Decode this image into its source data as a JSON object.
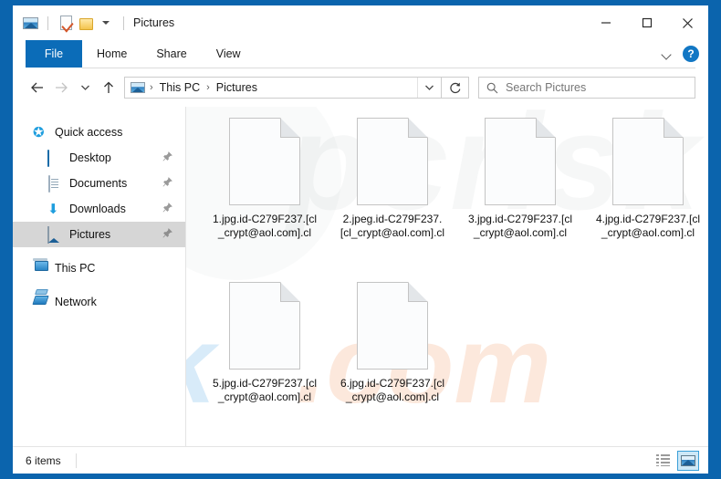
{
  "window": {
    "title": "Pictures",
    "quick_access_toolbar": [
      {
        "name": "picture-icon",
        "tooltip": "Pictures"
      },
      {
        "name": "properties-icon",
        "tooltip": "Properties"
      },
      {
        "name": "new-folder-icon",
        "tooltip": "New folder"
      },
      {
        "name": "chevron-down-icon",
        "tooltip": "Customize Quick Access Toolbar"
      }
    ],
    "controls": {
      "minimize": "minimize-icon",
      "maximize": "maximize-icon",
      "close": "close-icon"
    }
  },
  "ribbon": {
    "tabs": [
      {
        "label": "File",
        "active": true
      },
      {
        "label": "Home",
        "active": false
      },
      {
        "label": "Share",
        "active": false
      },
      {
        "label": "View",
        "active": false
      }
    ],
    "expand_icon": "chevron-down-icon",
    "help_label": "?"
  },
  "address_bar": {
    "back_icon": "arrow-left-icon",
    "forward_icon": "arrow-right-icon",
    "history_icon": "chevron-down-icon",
    "up_icon": "arrow-up-icon",
    "location_icon": "picture-folder-icon",
    "breadcrumbs": [
      "This PC",
      "Pictures"
    ],
    "separator": "›",
    "dropdown_icon": "chevron-down-icon",
    "refresh_icon": "refresh-icon"
  },
  "search": {
    "icon": "search-icon",
    "placeholder": "Search Pictures",
    "value": ""
  },
  "sidebar": {
    "items": [
      {
        "label": "Quick access",
        "icon": "star-icon",
        "level": 0,
        "pinned": false,
        "selected": false
      },
      {
        "label": "Desktop",
        "icon": "desktop-icon",
        "level": 1,
        "pinned": true,
        "selected": false
      },
      {
        "label": "Documents",
        "icon": "documents-icon",
        "level": 1,
        "pinned": true,
        "selected": false
      },
      {
        "label": "Downloads",
        "icon": "downloads-icon",
        "level": 1,
        "pinned": true,
        "selected": false
      },
      {
        "label": "Pictures",
        "icon": "pictures-icon",
        "level": 1,
        "pinned": true,
        "selected": true
      },
      {
        "label": "This PC",
        "icon": "this-pc-icon",
        "level": 0,
        "pinned": false,
        "selected": false
      },
      {
        "label": "Network",
        "icon": "network-icon",
        "level": 0,
        "pinned": false,
        "selected": false
      }
    ]
  },
  "files": [
    {
      "name": "1.jpg.id-C279F237.[cl_crypt@aol.com].cl",
      "icon": "blank-file-icon"
    },
    {
      "name": "2.jpeg.id-C279F237.[cl_crypt@aol.com].cl",
      "icon": "blank-file-icon"
    },
    {
      "name": "3.jpg.id-C279F237.[cl_crypt@aol.com].cl",
      "icon": "blank-file-icon"
    },
    {
      "name": "4.jpg.id-C279F237.[cl_crypt@aol.com].cl",
      "icon": "blank-file-icon"
    },
    {
      "name": "5.jpg.id-C279F237.[cl_crypt@aol.com].cl",
      "icon": "blank-file-icon"
    },
    {
      "name": "6.jpg.id-C279F237.[cl_crypt@aol.com].cl",
      "icon": "blank-file-icon"
    }
  ],
  "watermark": {
    "gray_text": "pcrisk",
    "blue_text": "risk",
    "orange_text": ".com"
  },
  "status_bar": {
    "item_count": "6 items",
    "views": [
      {
        "name": "details-view",
        "active": false
      },
      {
        "name": "large-icons-view",
        "active": true
      }
    ]
  },
  "colors": {
    "desktop_blue": "#0b64ad",
    "file_tab_blue": "#0b6cb8",
    "selection_gray": "#d6d6d6",
    "accent_blue": "#1277c4"
  }
}
